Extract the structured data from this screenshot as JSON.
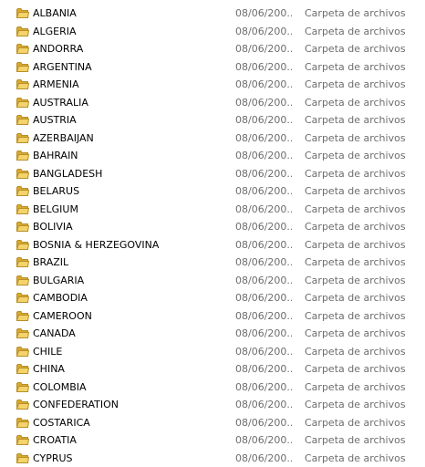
{
  "colors": {
    "folder_body": "#e8c14d",
    "folder_edge": "#b8902a",
    "secondary_text": "#6d6d6d"
  },
  "icon": "folder-icon",
  "files": [
    {
      "name": "ALBANIA",
      "date": "08/06/200...",
      "type": "Carpeta de archivos"
    },
    {
      "name": "ALGERIA",
      "date": "08/06/200...",
      "type": "Carpeta de archivos"
    },
    {
      "name": "ANDORRA",
      "date": "08/06/200...",
      "type": "Carpeta de archivos"
    },
    {
      "name": "ARGENTINA",
      "date": "08/06/200...",
      "type": "Carpeta de archivos"
    },
    {
      "name": "ARMENIA",
      "date": "08/06/200...",
      "type": "Carpeta de archivos"
    },
    {
      "name": "AUSTRALIA",
      "date": "08/06/200...",
      "type": "Carpeta de archivos"
    },
    {
      "name": "AUSTRIA",
      "date": "08/06/200...",
      "type": "Carpeta de archivos"
    },
    {
      "name": "AZERBAIJAN",
      "date": "08/06/200...",
      "type": "Carpeta de archivos"
    },
    {
      "name": "BAHRAIN",
      "date": "08/06/200...",
      "type": "Carpeta de archivos"
    },
    {
      "name": "BANGLADESH",
      "date": "08/06/200...",
      "type": "Carpeta de archivos"
    },
    {
      "name": "BELARUS",
      "date": "08/06/200...",
      "type": "Carpeta de archivos"
    },
    {
      "name": "BELGIUM",
      "date": "08/06/200...",
      "type": "Carpeta de archivos"
    },
    {
      "name": "BOLIVIA",
      "date": "08/06/200...",
      "type": "Carpeta de archivos"
    },
    {
      "name": "BOSNIA & HERZEGOVINA",
      "date": "08/06/200...",
      "type": "Carpeta de archivos"
    },
    {
      "name": "BRAZIL",
      "date": "08/06/200...",
      "type": "Carpeta de archivos"
    },
    {
      "name": "BULGARIA",
      "date": "08/06/200...",
      "type": "Carpeta de archivos"
    },
    {
      "name": "CAMBODIA",
      "date": "08/06/200...",
      "type": "Carpeta de archivos"
    },
    {
      "name": "CAMEROON",
      "date": "08/06/200...",
      "type": "Carpeta de archivos"
    },
    {
      "name": "CANADA",
      "date": "08/06/200...",
      "type": "Carpeta de archivos"
    },
    {
      "name": "CHILE",
      "date": "08/06/200...",
      "type": "Carpeta de archivos"
    },
    {
      "name": "CHINA",
      "date": "08/06/200...",
      "type": "Carpeta de archivos"
    },
    {
      "name": "COLOMBIA",
      "date": "08/06/200...",
      "type": "Carpeta de archivos"
    },
    {
      "name": "CONFEDERATION",
      "date": "08/06/200...",
      "type": "Carpeta de archivos"
    },
    {
      "name": "COSTARICA",
      "date": "08/06/200...",
      "type": "Carpeta de archivos"
    },
    {
      "name": "CROATIA",
      "date": "08/06/200...",
      "type": "Carpeta de archivos"
    },
    {
      "name": "CYPRUS",
      "date": "08/06/200...",
      "type": "Carpeta de archivos"
    }
  ]
}
